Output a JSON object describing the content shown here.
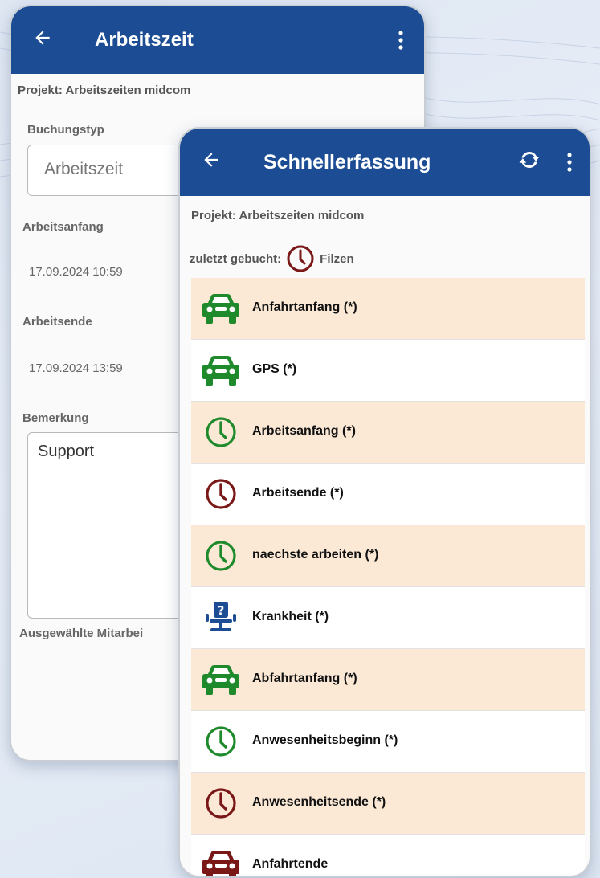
{
  "colors": {
    "appbar": "#1c4c93",
    "highlight_row": "#fbe9d6",
    "green": "#1f8a2b",
    "darkred": "#7a1717",
    "blue": "#1c4c93"
  },
  "back_screen": {
    "title": "Arbeitszeit",
    "project": "Projekt: Arbeitszeiten midcom",
    "booking_type_label": "Buchungstyp",
    "booking_type_value": "Arbeitszeit",
    "start_label": "Arbeitsanfang",
    "start_value": "17.09.2024 10:59",
    "end_label": "Arbeitsende",
    "end_value": "17.09.2024 13:59",
    "note_label": "Bemerkung",
    "note_value": "Support",
    "employees_label": "Ausgewählte Mitarbei"
  },
  "front_screen": {
    "title": "Schnellerfassung",
    "project": "Projekt: Arbeitszeiten midcom",
    "last_booked_label": "zuletzt gebucht:",
    "last_booked_value": "Filzen",
    "last_booked_icon": "clock-icon",
    "items": [
      {
        "label": "Anfahrtanfang (*)",
        "icon": "car-icon",
        "color": "green",
        "highlight": true
      },
      {
        "label": "GPS (*)",
        "icon": "car-icon",
        "color": "green",
        "highlight": false
      },
      {
        "label": "Arbeitsanfang (*)",
        "icon": "clock-icon",
        "color": "green",
        "highlight": true
      },
      {
        "label": "Arbeitsende (*)",
        "icon": "clock-icon",
        "color": "darkred",
        "highlight": false
      },
      {
        "label": "naechste arbeiten (*)",
        "icon": "clock-icon",
        "color": "green",
        "highlight": true
      },
      {
        "label": "Krankheit (*)",
        "icon": "sick-chair-icon",
        "color": "blue",
        "highlight": false
      },
      {
        "label": "Abfahrtanfang (*)",
        "icon": "car-icon",
        "color": "green",
        "highlight": true
      },
      {
        "label": "Anwesenheitsbeginn (*)",
        "icon": "clock-icon",
        "color": "green",
        "highlight": false
      },
      {
        "label": "Anwesenheitsende (*)",
        "icon": "clock-icon",
        "color": "darkred",
        "highlight": true
      },
      {
        "label": "Anfahrtende",
        "icon": "car-icon",
        "color": "darkred",
        "highlight": false
      }
    ]
  }
}
